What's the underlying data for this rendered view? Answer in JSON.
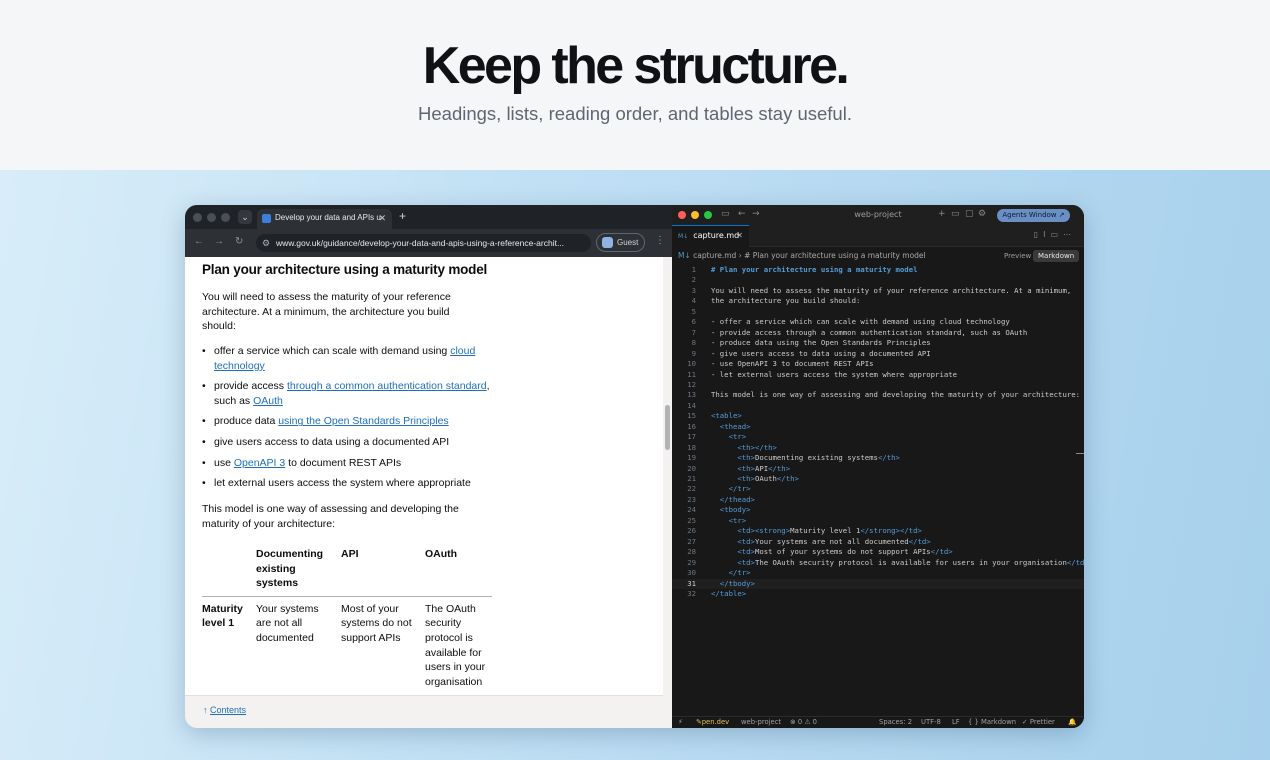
{
  "hero": {
    "title": "Keep the structure.",
    "subtitle": "Headings, lists, reading order, and tables stay useful."
  },
  "browser": {
    "tab_title": "Develop your data and APIs u",
    "new_tab": "+",
    "url": "www.gov.uk/guidance/develop-your-data-and-apis-using-a-reference-archit...",
    "profile": "Guest",
    "page": {
      "heading": "Plan your architecture using a maturity model",
      "intro": "You will need to assess the maturity of your reference architecture. At a minimum, the architecture you build should:",
      "bullets": [
        {
          "pre": "offer a service which can scale with demand using ",
          "link": "cloud technology",
          "post": ""
        },
        {
          "pre": "provide access ",
          "link": "through a common authentication standard",
          "post": ", such as ",
          "link2": "OAuth"
        },
        {
          "pre": "produce data ",
          "link": "using the Open Standards Principles",
          "post": ""
        },
        {
          "pre": "give users access to data using a documented API",
          "link": "",
          "post": ""
        },
        {
          "pre": "use ",
          "link": "OpenAPI 3",
          "post": " to document REST APIs"
        },
        {
          "pre": "let external users access the system where appropriate",
          "link": "",
          "post": ""
        }
      ],
      "outro": "This model is one way of assessing and developing the maturity of your architecture:",
      "table": {
        "headers": [
          "",
          "Documenting existing systems",
          "API",
          "OAuth"
        ],
        "row": [
          "Maturity level 1",
          "Your systems are not all documented",
          "Most of your systems do not support APIs",
          "The OAuth security protocol is available for users in your organisation"
        ]
      },
      "contents_link": "Contents"
    }
  },
  "editor": {
    "window_title": "web-project",
    "agents_button": "Agents Window ↗",
    "tab_name": "capture.md",
    "tab_badge": "M↓",
    "breadcrumb_file": "capture.md",
    "breadcrumb_symbol": "# Plan your architecture using a maturity model",
    "preview_label": "Preview",
    "markdown_label": "Markdown",
    "current_line": 31,
    "lines": [
      "# Plan your architecture using a maturity model",
      "",
      "You will need to assess the maturity of your reference architecture. At a minimum,",
      "the architecture you build should:",
      "",
      "- offer a service which can scale with demand using cloud technology",
      "- provide access through a common authentication standard, such as OAuth",
      "- produce data using the Open Standards Principles",
      "- give users access to data using a documented API",
      "- use OpenAPI 3 to document REST APIs",
      "- let external users access the system where appropriate",
      "",
      "This model is one way of assessing and developing the maturity of your architecture:",
      "",
      "<table>",
      "  <thead>",
      "    <tr>",
      "      <th></th>",
      "      <th>Documenting existing systems</th>",
      "      <th>API</th>",
      "      <th>OAuth</th>",
      "    </tr>",
      "  </thead>",
      "  <tbody>",
      "    <tr>",
      "      <td><strong>Maturity level 1</strong></td>",
      "      <td>Your systems are not all documented</td>",
      "      <td>Most of your systems do not support APIs</td>",
      "      <td>The OAuth security protocol is available for users in your organisation</td>",
      "    </tr>",
      "  </tbody>",
      "</table>"
    ],
    "status": {
      "branch": "pen.dev",
      "project": "web-project",
      "problems": "⊗ 0 ⚠ 0",
      "spaces": "Spaces: 2",
      "encoding": "UTF-8",
      "eol": "LF",
      "language": "{ } Markdown",
      "formatter": "✓ Prettier"
    }
  },
  "colors": {
    "link": "#1d70b8",
    "tag": "#569cd6",
    "band_start": "#d8edf9",
    "band_end": "#a7d0ec"
  }
}
